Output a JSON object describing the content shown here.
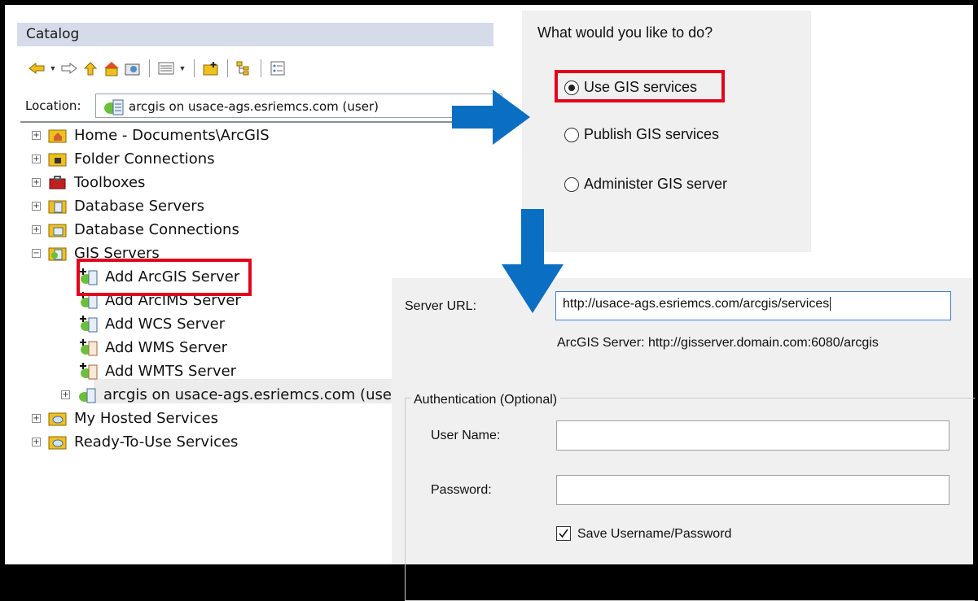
{
  "catalog": {
    "title": "Catalog",
    "location_label": "Location:",
    "location_value": "arcgis on usace-ags.esriemcs.com (user)",
    "tree": [
      {
        "label": "Home - Documents\\ArcGIS",
        "expander": "+"
      },
      {
        "label": "Folder Connections",
        "expander": "+"
      },
      {
        "label": "Toolboxes",
        "expander": "+"
      },
      {
        "label": "Database Servers",
        "expander": "+"
      },
      {
        "label": "Database Connections",
        "expander": "+"
      },
      {
        "label": "GIS Servers",
        "expander": "−"
      },
      {
        "label": "Add ArcGIS Server"
      },
      {
        "label": "Add ArcIMS Server"
      },
      {
        "label": "Add WCS Server"
      },
      {
        "label": "Add WMS Server"
      },
      {
        "label": "Add WMTS Server"
      },
      {
        "label": "arcgis on usace-ags.esriemcs.com (use",
        "expander": "+"
      },
      {
        "label": "My Hosted Services",
        "expander": "+"
      },
      {
        "label": "Ready-To-Use Services",
        "expander": "+"
      }
    ]
  },
  "choice_dialog": {
    "question": "What would you like to do?",
    "options": [
      {
        "label": "Use GIS services",
        "selected": true
      },
      {
        "label": "Publish GIS services",
        "selected": false
      },
      {
        "label": "Administer GIS server",
        "selected": false
      }
    ]
  },
  "server_dialog": {
    "server_url_label": "Server URL:",
    "server_url_value": "http://usace-ags.esriemcs.com/arcgis/services",
    "server_url_hint": "ArcGIS Server: http://gisserver.domain.com:6080/arcgis",
    "auth_group_title": "Authentication (Optional)",
    "username_label": "User Name:",
    "username_value": "",
    "password_label": "Password:",
    "password_value": "",
    "save_label": "Save Username/Password",
    "save_checked": true
  },
  "colors": {
    "highlight_red": "#e1051c",
    "arrow_blue": "#0a6fc2",
    "panel_title_bg": "#d6dbe9",
    "dialog_bg": "#f0f0f0"
  }
}
